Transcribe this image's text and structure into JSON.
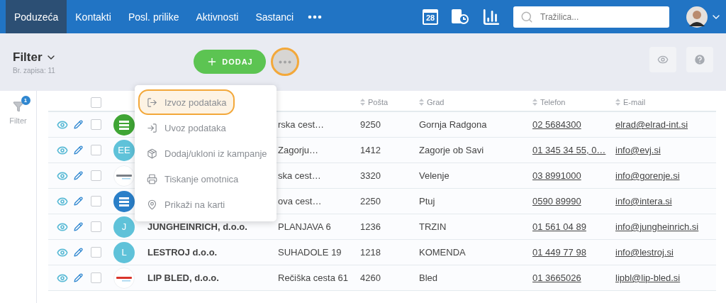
{
  "nav": {
    "tabs": [
      {
        "label": "Poduzeća",
        "selected": true
      },
      {
        "label": "Kontakti",
        "selected": false
      },
      {
        "label": "Posl. prilike",
        "selected": false
      },
      {
        "label": "Aktivnosti",
        "selected": false
      },
      {
        "label": "Sastanci",
        "selected": false
      }
    ],
    "calendar_day": "28",
    "search": {
      "placeholder": "Tražilica..."
    }
  },
  "toolbar": {
    "title": "Filter",
    "count": "Br. zapisa: 11",
    "add_button": "DODAJ",
    "more_active": true
  },
  "sidebar": {
    "filter_label": "Filter",
    "badge": "1"
  },
  "menu": {
    "items": [
      {
        "label": "Izvoz podataka",
        "selected": true,
        "kind": "export"
      },
      {
        "label": "Uvoz podataka",
        "selected": false,
        "kind": "import"
      },
      {
        "label": "Dodaj/ukloni iz kampanje",
        "selected": false,
        "kind": "box"
      },
      {
        "label": "Tiskanje omotnica",
        "selected": false,
        "kind": "print"
      },
      {
        "label": "Prikaži na karti",
        "selected": false,
        "kind": "pin"
      }
    ]
  },
  "table": {
    "header_checked": false,
    "columns": [
      {
        "label": "Pošta"
      },
      {
        "label": "Grad"
      },
      {
        "label": "Telefon"
      },
      {
        "label": "E-mail"
      }
    ],
    "rows": [
      {
        "checked": false,
        "avatar": {
          "kind": "logo",
          "color": "#3fa535"
        },
        "address": "rska cest…",
        "posta": "9250",
        "grad": "Gornja Radgona",
        "telefon": "02 5684300",
        "email": "elrad@elrad-int.si"
      },
      {
        "checked": false,
        "avatar": {
          "kind": "initials",
          "text": "EE",
          "color": "#5fc2d9"
        },
        "address": "Zagorju…",
        "posta": "1412",
        "grad": "Zagorje ob Savi",
        "telefon": "01 345 34 55, 0…",
        "email": "info@evj.si"
      },
      {
        "checked": false,
        "avatar": {
          "kind": "wordmark",
          "color": "#7a7f86"
        },
        "address": "ska cest…",
        "posta": "3320",
        "grad": "Velenje",
        "telefon": "03 8991000",
        "email": "info@gorenje.si"
      },
      {
        "checked": false,
        "avatar": {
          "kind": "logo",
          "color": "#2a7fc8"
        },
        "address": "ova cest…",
        "posta": "2250",
        "grad": "Ptuj",
        "telefon": "0590 89990",
        "email": "info@intera.si"
      },
      {
        "checked": false,
        "avatar": {
          "kind": "initials",
          "text": "J",
          "color": "#5fc2d9"
        },
        "name": "JUNGHEINRICH, d.o.o.",
        "address": "PLANJAVA 6",
        "posta": "1236",
        "grad": "TRZIN",
        "telefon": "01 561 04 89",
        "email": "info@jungheinrich.si"
      },
      {
        "checked": false,
        "avatar": {
          "kind": "initials",
          "text": "L",
          "color": "#5fc2d9"
        },
        "name": "LESTROJ d.o.o.",
        "address": "SUHADOLE 19",
        "posta": "1218",
        "grad": "KOMENDA",
        "telefon": "01 449 77 98",
        "email": "info@lestroj.si"
      },
      {
        "checked": false,
        "avatar": {
          "kind": "wordmark",
          "color": "#d9342b"
        },
        "name": "LIP BLED, d.o.o.",
        "address": "Rečiška cesta 61",
        "posta": "4260",
        "grad": "Bled",
        "telefon": "01 3665026",
        "email": "lipbl@lip-bled.si"
      }
    ]
  }
}
